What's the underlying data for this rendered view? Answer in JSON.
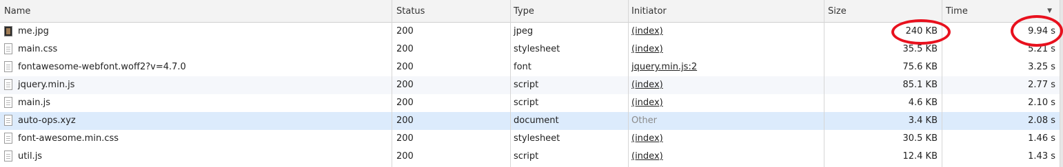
{
  "columns": {
    "name": "Name",
    "status": "Status",
    "type": "Type",
    "initiator": "Initiator",
    "size": "Size",
    "time": "Time"
  },
  "sort_indicator": "▼",
  "rows": [
    {
      "name": "me.jpg",
      "status": "200",
      "type": "jpeg",
      "initiator": "(index)",
      "size": "240 KB",
      "time": "9.94 s",
      "icon": "image-file-icon"
    },
    {
      "name": "main.css",
      "status": "200",
      "type": "stylesheet",
      "initiator": "(index)",
      "size": "35.5 KB",
      "time": "5.21 s",
      "icon": "document-icon"
    },
    {
      "name": "fontawesome-webfont.woff2?v=4.7.0",
      "status": "200",
      "type": "font",
      "initiator": "jquery.min.js:2",
      "size": "75.6 KB",
      "time": "3.25 s",
      "icon": "document-icon"
    },
    {
      "name": "jquery.min.js",
      "status": "200",
      "type": "script",
      "initiator": "(index)",
      "size": "85.1 KB",
      "time": "2.77 s",
      "icon": "document-icon"
    },
    {
      "name": "main.js",
      "status": "200",
      "type": "script",
      "initiator": "(index)",
      "size": "4.6 KB",
      "time": "2.10 s",
      "icon": "document-icon"
    },
    {
      "name": "auto-ops.xyz",
      "status": "200",
      "type": "document",
      "initiator": "Other",
      "size": "3.4 KB",
      "time": "2.08 s",
      "icon": "document-icon"
    },
    {
      "name": "font-awesome.min.css",
      "status": "200",
      "type": "stylesheet",
      "initiator": "(index)",
      "size": "30.5 KB",
      "time": "1.46 s",
      "icon": "document-icon"
    },
    {
      "name": "util.js",
      "status": "200",
      "type": "script",
      "initiator": "(index)",
      "size": "12.4 KB",
      "time": "1.43 s",
      "icon": "document-icon"
    }
  ],
  "colors": {
    "highlight_row": "#dcebfc",
    "annotation": "#e8111e"
  }
}
